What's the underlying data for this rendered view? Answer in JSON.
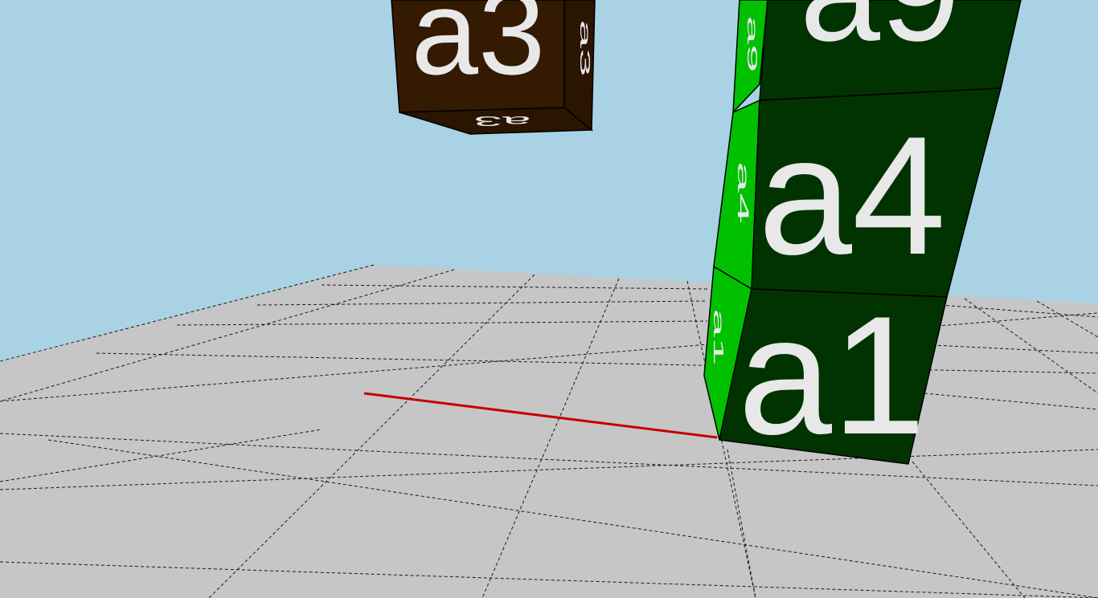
{
  "scene": {
    "sky_color": "#a9d3e5",
    "floor_color": "#c6c6c6",
    "grid_line_color": "#1a1a1a",
    "axis_line_color": "#c40000"
  },
  "cubes": [
    {
      "id": "a3",
      "label": "a3",
      "front_color": "#331a00",
      "side_color": "#2a1500",
      "bottom_color": "#2a1500"
    },
    {
      "id": "a9",
      "label": "a9",
      "front_color": "#003300",
      "side_color": "#00c000"
    },
    {
      "id": "a4",
      "label": "a4",
      "front_color": "#003300",
      "side_color": "#00c000"
    },
    {
      "id": "a1",
      "label": "a1",
      "front_color": "#003300",
      "side_color": "#00c000"
    }
  ]
}
